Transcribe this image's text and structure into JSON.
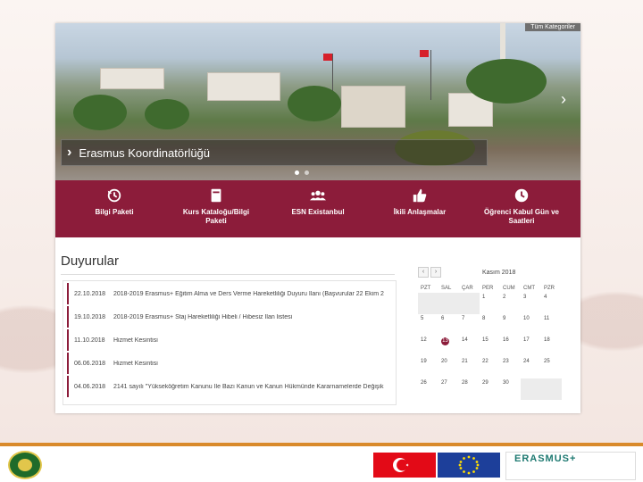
{
  "header": {
    "user_tab": "Tüm Kategoriler",
    "banner_title": "Erasmus Koordinatörlüğü"
  },
  "nav": [
    {
      "label": "Bilgi Paketi",
      "icon": "history-icon"
    },
    {
      "label": "Kurs Kataloğu/Bilgi Paketi",
      "icon": "book-icon"
    },
    {
      "label": "ESN Existanbul",
      "icon": "users-icon"
    },
    {
      "label": "İkili Anlaşmalar",
      "icon": "thumbs-up-icon"
    },
    {
      "label": "Öğrenci Kabul Gün ve Saatleri",
      "icon": "clock-icon"
    }
  ],
  "announcements": {
    "title": "Duyurular",
    "items": [
      {
        "date": "22.10.2018",
        "text": "2018-2019 Erasmus+ Eğitim Alma ve Ders Verme Hareketliliği Duyuru İlanı (Başvurular 22 Ekim 2"
      },
      {
        "date": "19.10.2018",
        "text": "2018-2019 Erasmus+ Staj Hareketliliği Hibeli / Hibesiz İlan listesi"
      },
      {
        "date": "11.10.2018",
        "text": "Hizmet Kesintisi"
      },
      {
        "date": "06.06.2018",
        "text": "Hizmet Kesintisi"
      },
      {
        "date": "04.06.2018",
        "text": "2141 sayılı \"Yükseköğretim Kanunu İle Bazı Kanun ve Kanun Hükmünde Kararnamelerde Değişik"
      }
    ]
  },
  "calendar": {
    "month": "Kasım 2018",
    "prev": "‹",
    "next": "›",
    "days_of_week": [
      "PZT",
      "SAL",
      "ÇAR",
      "PER",
      "CUM",
      "CMT",
      "PZR"
    ],
    "weeks": [
      [
        "",
        "",
        "",
        "1",
        "2",
        "3",
        "4"
      ],
      [
        "5",
        "6",
        "7",
        "8",
        "9",
        "10",
        "11"
      ],
      [
        "12",
        "13",
        "14",
        "15",
        "16",
        "17",
        "18"
      ],
      [
        "19",
        "20",
        "21",
        "22",
        "23",
        "24",
        "25"
      ],
      [
        "26",
        "27",
        "28",
        "29",
        "30",
        "",
        ""
      ]
    ],
    "today": "13"
  },
  "footer": {
    "erasmus": "ERASMUS+"
  },
  "colors": {
    "brand": "#8c1c3a",
    "accent": "#d98a2b"
  }
}
